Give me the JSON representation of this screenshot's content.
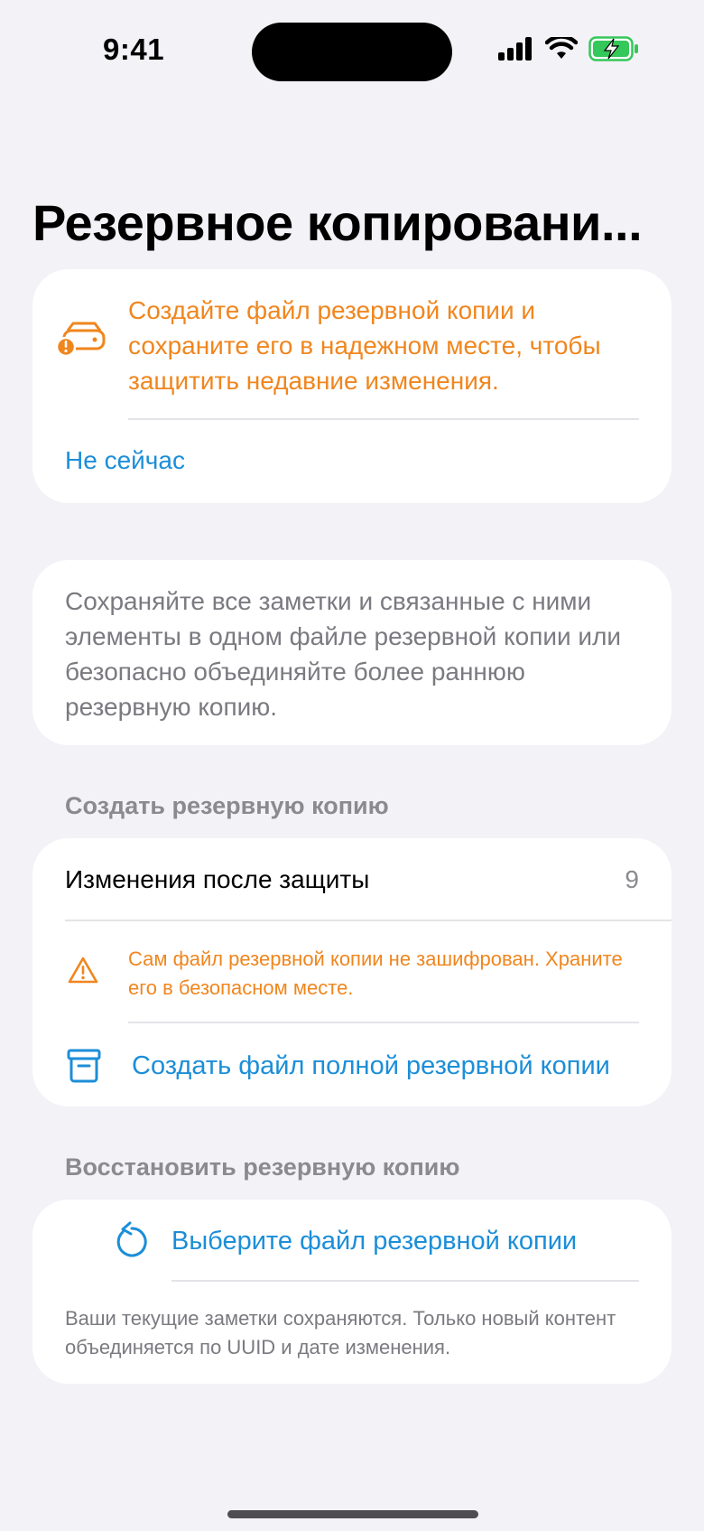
{
  "status_bar": {
    "time": "9:41"
  },
  "page": {
    "title": "Резервное копировани..."
  },
  "backup_warning": {
    "icon": "drive-alert-icon",
    "message": "Создайте файл резервной копии и сохраните его в надежном месте, чтобы защитить недавние изменения.",
    "dismiss_label": "Не сейчас",
    "color": "#F0861E"
  },
  "info": {
    "text": "Сохраняйте все заметки и связанные с ними элементы в одном файле резервной копии или безопасно объединяйте более раннюю резервную копию."
  },
  "create_section": {
    "header": "Создать резервную копию",
    "changes_label": "Изменения после защиты",
    "changes_count": "9",
    "alert_icon": "warning-triangle-icon",
    "alert_text": "Сам файл резервной копии не зашифрован. Храните его в безопасном месте.",
    "create_icon": "archive-box-icon",
    "create_button": "Создать файл полной резервной копии"
  },
  "restore_section": {
    "header": "Восстановить резервную копию",
    "icon": "restore-arrow-icon",
    "choose_button": "Выберите файл резервной копии",
    "note": "Ваши текущие заметки сохраняются. Только новый контент объединяется по UUID и дате изменения."
  },
  "colors": {
    "accent": "#1C8ED8",
    "warning": "#F0861E",
    "battery": "#34C759"
  }
}
